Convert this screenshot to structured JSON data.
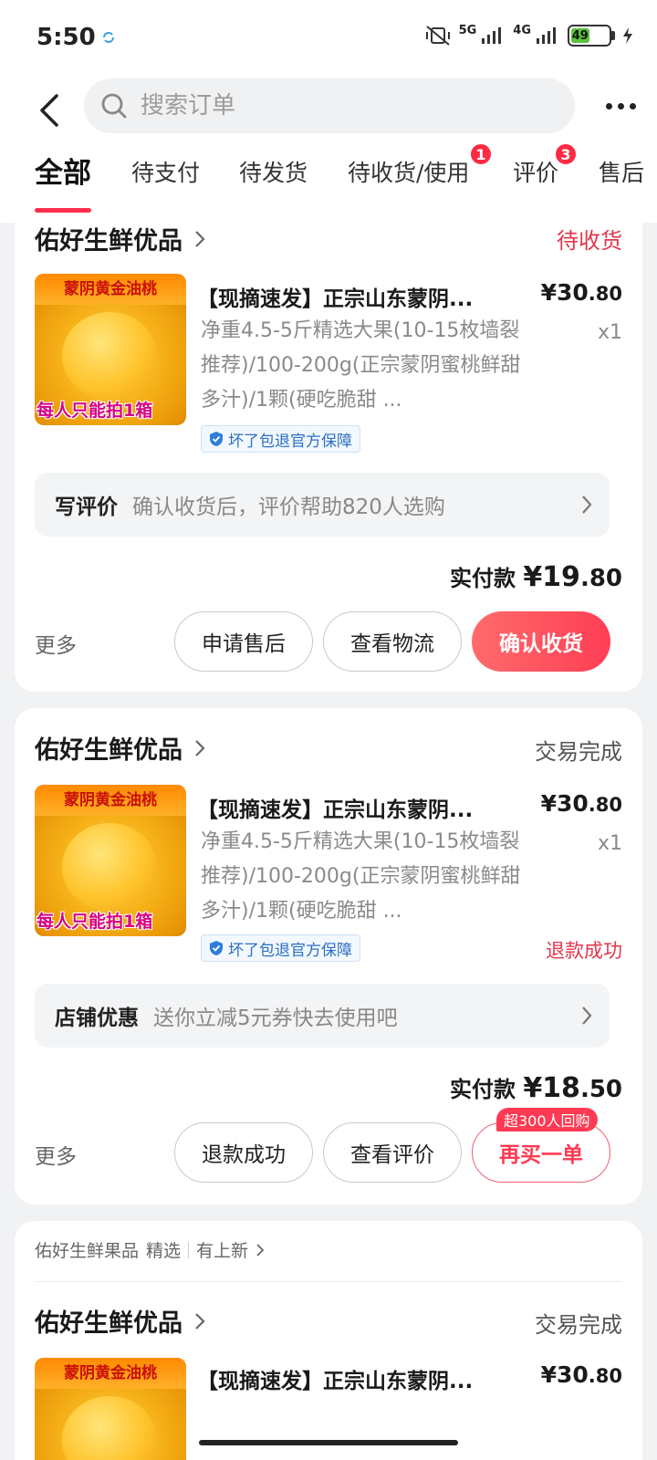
{
  "status_bar": {
    "time": "5:50",
    "network_1": "5G",
    "network_2": "4G",
    "battery": "49"
  },
  "header": {
    "search_placeholder": "搜索订单"
  },
  "tabs": [
    {
      "label": "全部",
      "active": true
    },
    {
      "label": "待支付"
    },
    {
      "label": "待发货"
    },
    {
      "label": "待收货/使用",
      "badge": "1"
    },
    {
      "label": "评价",
      "badge": "3"
    },
    {
      "label": "售后"
    }
  ],
  "orders": [
    {
      "shop": "佑好生鲜优品",
      "status": "待收货",
      "status_color": "#e2364b",
      "image_top": "蒙阴黄金油桃",
      "image_bottom": "每人只能拍1箱",
      "title": "【现摘速发】正宗山东蒙阴...",
      "price_main": "¥30",
      "price_dec": ".80",
      "spec": "净重4.5-5斤精选大果(10-15枚墙裂推荐)/100-200g(正宗蒙阴蜜桃鲜甜多汁)/1颗(硬吃脆甜 ...",
      "qty": "x1",
      "guarantee": "坏了包退官方保障",
      "info_label": "写评价",
      "info_text": "确认收货后，评价帮助820人选购",
      "paid_label": "实付款",
      "paid_main": "¥19",
      "paid_dec": ".80",
      "more": "更多",
      "buttons": [
        "申请售后",
        "查看物流",
        "确认收货"
      ]
    },
    {
      "shop": "佑好生鲜优品",
      "status": "交易完成",
      "status_color": "#555555",
      "image_top": "蒙阴黄金油桃",
      "image_bottom": "每人只能拍1箱",
      "title": "【现摘速发】正宗山东蒙阴...",
      "price_main": "¥30",
      "price_dec": ".80",
      "spec": "净重4.5-5斤精选大果(10-15枚墙裂推荐)/100-200g(正宗蒙阴蜜桃鲜甜多汁)/1颗(硬吃脆甜 ...",
      "qty": "x1",
      "guarantee": "坏了包退官方保障",
      "refund": "退款成功",
      "info_label": "店铺优惠",
      "info_text": "送你立减5元券快去使用吧",
      "paid_label": "实付款",
      "paid_main": "¥18",
      "paid_dec": ".50",
      "more": "更多",
      "buttons": [
        "退款成功",
        "查看评价",
        "再买一单"
      ],
      "popular_tag": "超300人回购"
    },
    {
      "section_shop": "佑好生鲜果品",
      "section_tag": "精选",
      "section_link": "有上新",
      "shop": "佑好生鲜优品",
      "status": "交易完成",
      "image_top": "蒙阴黄金油桃",
      "title": "【现摘速发】正宗山东蒙阴...",
      "price_main": "¥30",
      "price_dec": ".80"
    }
  ],
  "colors": {
    "accent": "#ff3a52",
    "background": "#f1f2f4"
  }
}
